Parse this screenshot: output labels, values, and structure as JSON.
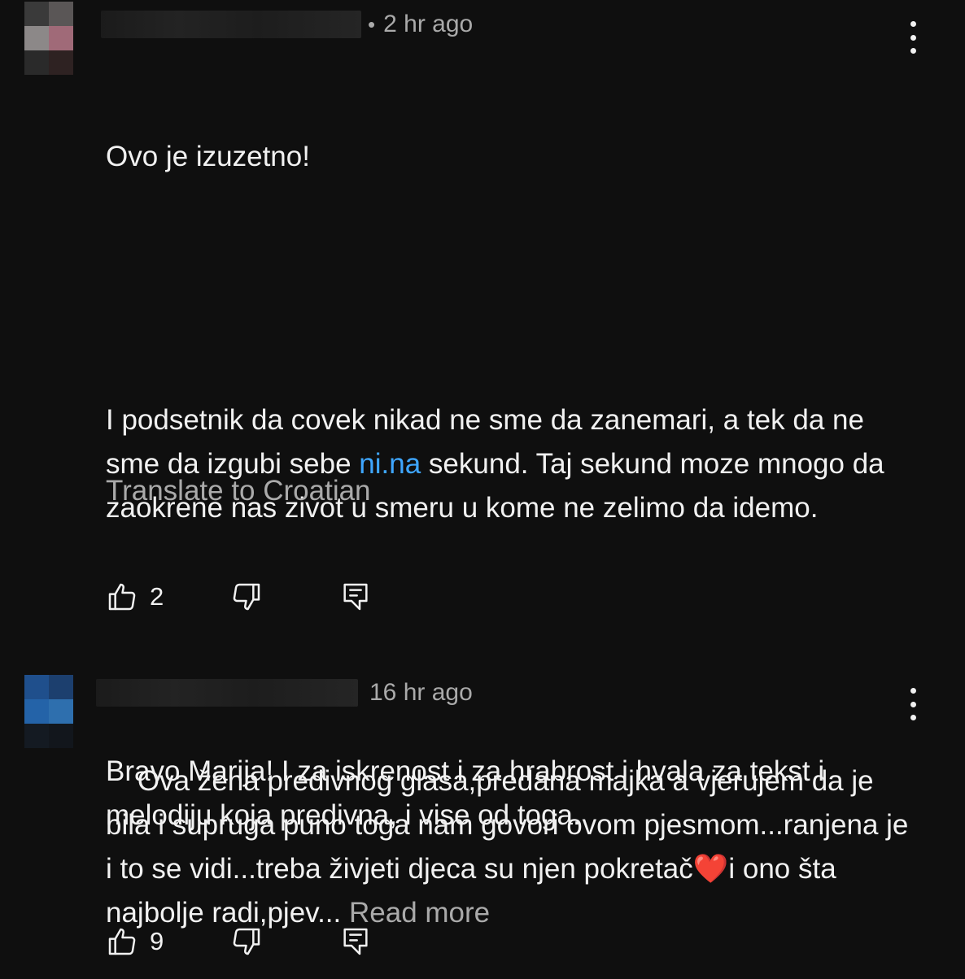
{
  "comments": [
    {
      "time": "2 hr ago",
      "separator": "•",
      "paragraph1": "Ovo je izuzetno!",
      "p2_before": "I podsetnik da covek nikad ne sme da zanemari, a tek da ne sme da izgubi sebe ",
      "p2_link": "ni.na",
      "p2_after": " sekund. Taj sekund moze mnogo da zaokrene nas zivot u smeru u kome ne zelimo da idemo.",
      "paragraph3": "Bravo Marija! I za iskrenost i za hrabrost i hvala za tekst i melodiju koja predivna, i vise od toga.",
      "translate_label": "Translate to Croatian",
      "like_count": "2",
      "icons": {
        "like": "thumbs-up-icon",
        "dislike": "thumbs-down-icon",
        "reply": "reply-icon",
        "menu": "more-vertical-icon"
      }
    },
    {
      "time": "16 hr ago",
      "text_before": "Ova žena predivnog glasa,predana majka a vjerujem da je bila i supruga puno toga nam govori ovom pjesmom...ranjena je i to se vidi...treba živjeti djeca su njen pokretač",
      "emoji": "❤️",
      "text_after": "i ono šta najbolje radi,pjev... ",
      "read_more": "Read more",
      "like_count": "9",
      "icons": {
        "like": "thumbs-up-icon",
        "dislike": "thumbs-down-icon",
        "reply": "reply-icon",
        "menu": "more-vertical-icon"
      }
    }
  ],
  "colors": {
    "background": "#0f0f0f",
    "text": "#f1f1f1",
    "secondary": "#aaaaaa",
    "link": "#3ea6ff"
  }
}
